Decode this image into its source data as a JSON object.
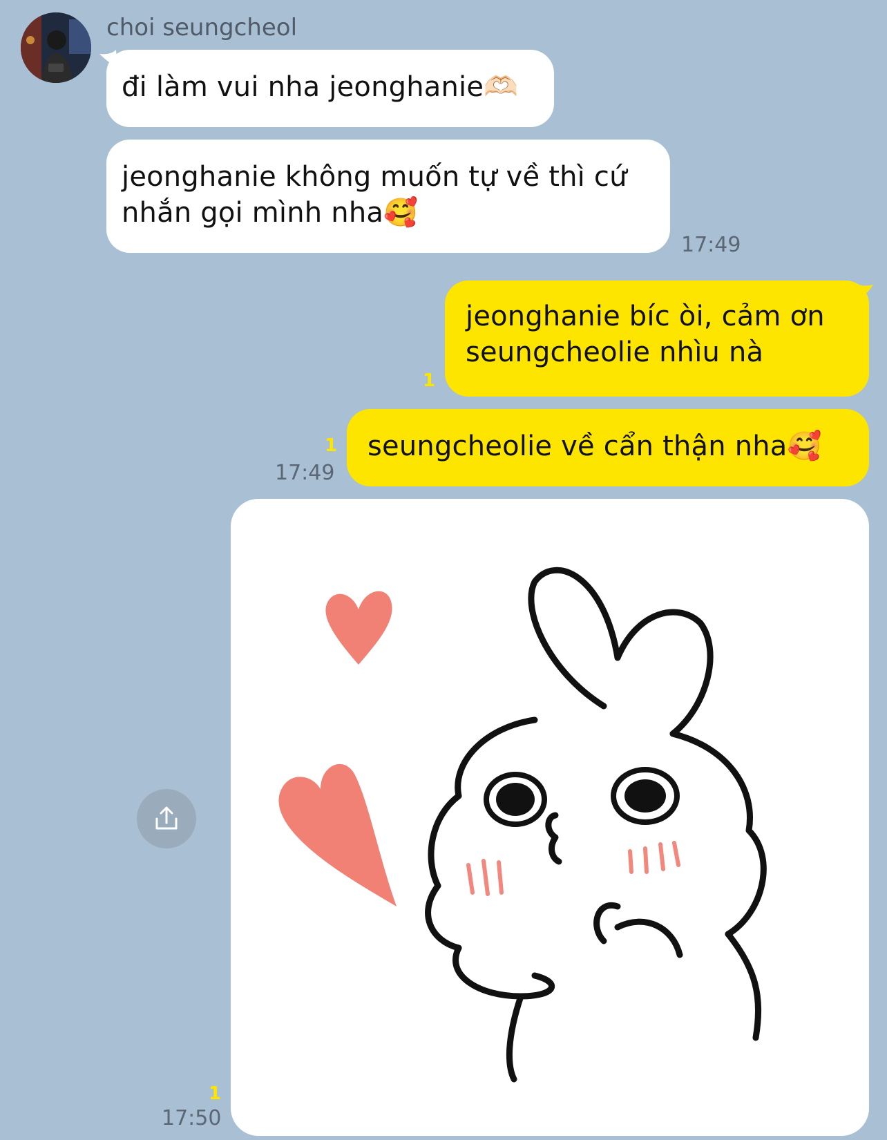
{
  "chat": {
    "sender_name": "choi seungcheol",
    "incoming": [
      {
        "text": "đi làm vui nha jeonghanie🫶🏻"
      },
      {
        "text": "jeonghanie không muốn tự về thì cứ nhắn gọi mình nha🥰"
      }
    ],
    "incoming_time": "17:49",
    "outgoing": [
      {
        "text": "jeonghanie bíc òi, cảm ơn seungcheolie nhìu nà",
        "unread": "1"
      },
      {
        "text": "seungcheolie về cẩn thận nha🥰",
        "unread": "1"
      }
    ],
    "outgoing_time": "17:49",
    "sticker": {
      "unread": "1",
      "time": "17:50"
    }
  },
  "icons": {
    "avatar": "profile-photo",
    "share": "share-upload-icon"
  },
  "colors": {
    "background": "#a9bfd3",
    "incoming_bubble": "#ffffff",
    "outgoing_bubble": "#fee500",
    "unread_count": "#fee500"
  }
}
